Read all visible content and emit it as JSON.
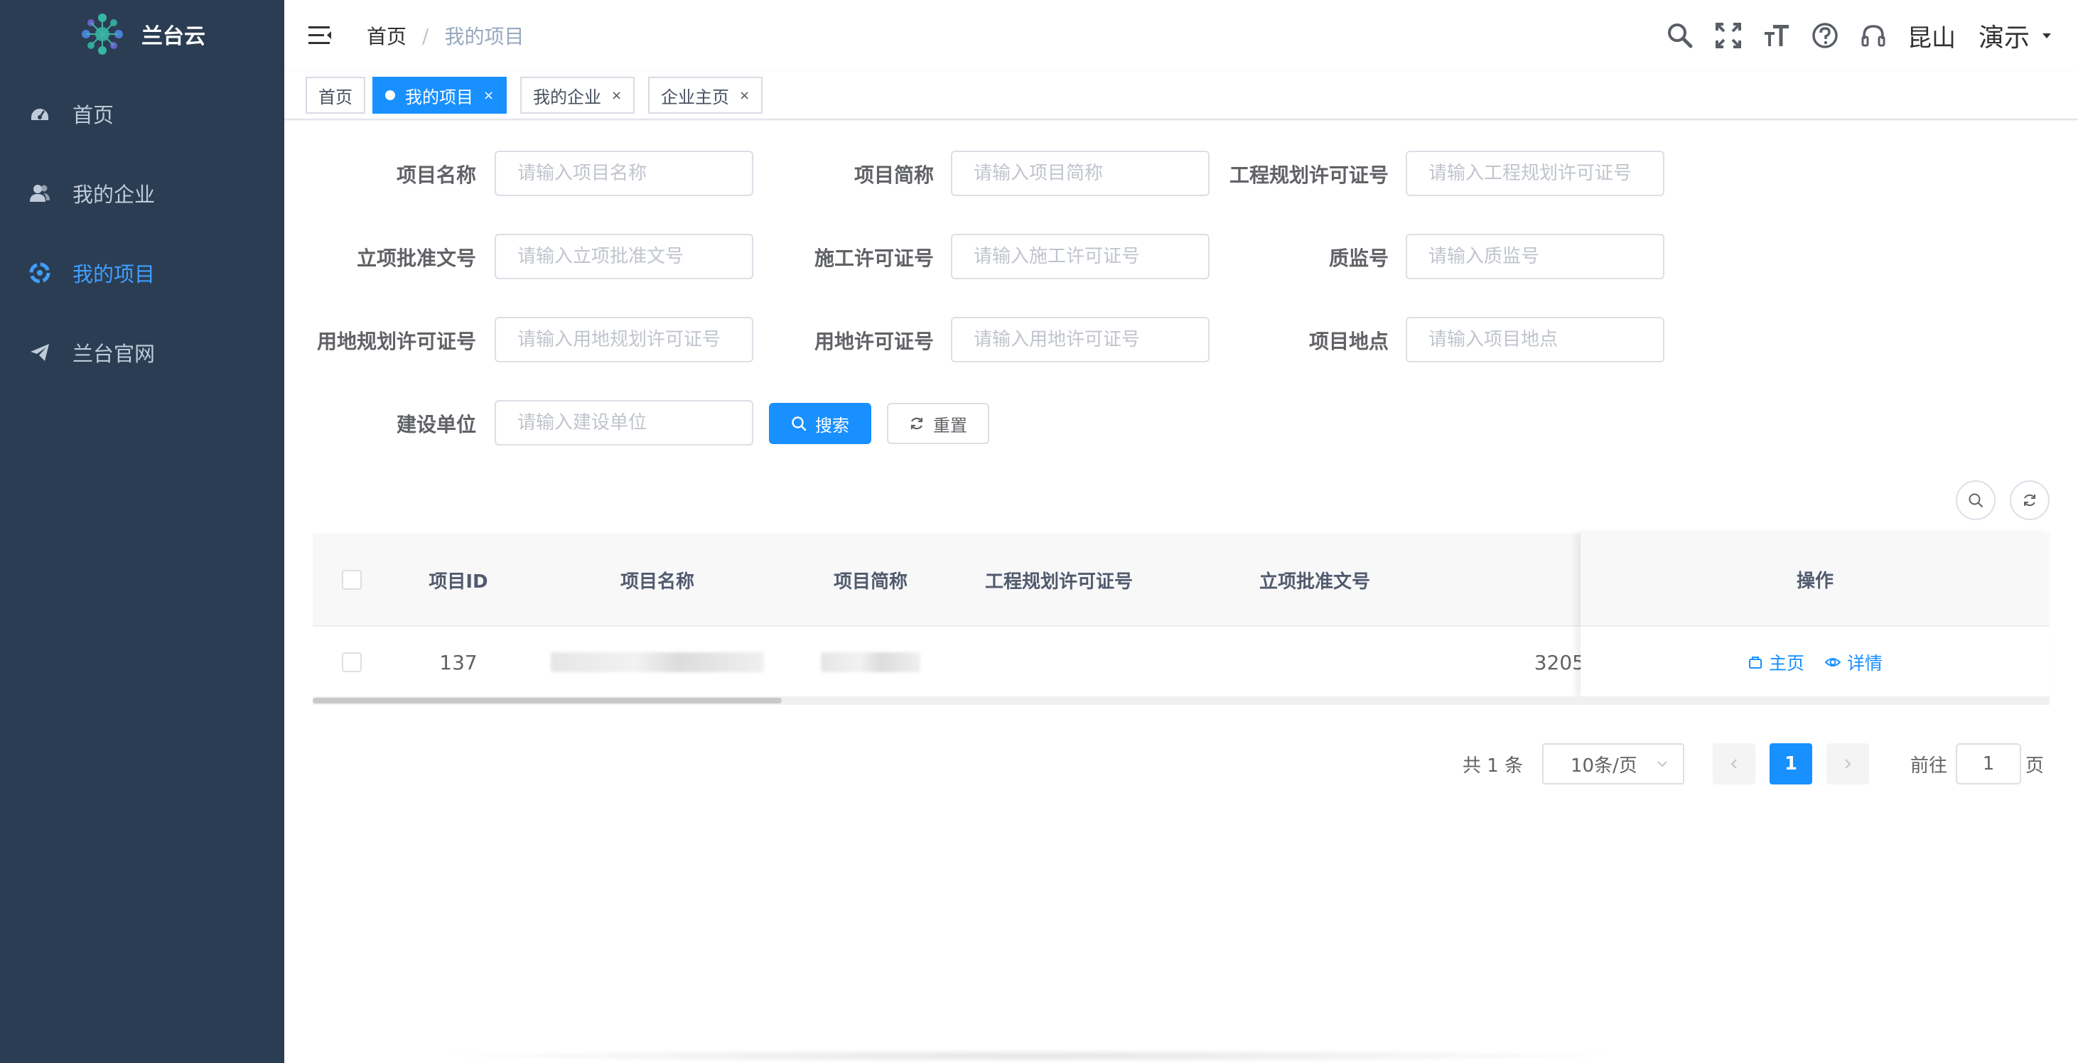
{
  "app": {
    "title": "兰台云"
  },
  "sidebar": {
    "items": [
      {
        "label": "首页",
        "icon": "dashboard-icon",
        "active": false
      },
      {
        "label": "我的企业",
        "icon": "users-icon",
        "active": false
      },
      {
        "label": "我的项目",
        "icon": "project-icon",
        "active": true
      },
      {
        "label": "兰台官网",
        "icon": "send-icon",
        "active": false
      }
    ]
  },
  "navbar": {
    "breadcrumb": [
      "首页",
      "我的项目"
    ],
    "breadcrumb_separator": "/",
    "icons": [
      "search-icon",
      "fullscreen-icon",
      "font-size-icon",
      "help-icon",
      "headset-icon"
    ],
    "location": "昆山",
    "user": "演示"
  },
  "tags": [
    {
      "label": "首页",
      "active": false,
      "closable": false
    },
    {
      "label": "我的项目",
      "active": true,
      "closable": true
    },
    {
      "label": "我的企业",
      "active": false,
      "closable": true
    },
    {
      "label": "企业主页",
      "active": false,
      "closable": true
    }
  ],
  "tag_close": "×",
  "search_form": {
    "fields": [
      {
        "label": "项目名称",
        "placeholder": "请输入项目名称",
        "value": ""
      },
      {
        "label": "项目简称",
        "placeholder": "请输入项目简称",
        "value": ""
      },
      {
        "label": "工程规划许可证号",
        "placeholder": "请输入工程规划许可证号",
        "value": ""
      },
      {
        "label": "立项批准文号",
        "placeholder": "请输入立项批准文号",
        "value": ""
      },
      {
        "label": "施工许可证号",
        "placeholder": "请输入施工许可证号",
        "value": ""
      },
      {
        "label": "质监号",
        "placeholder": "请输入质监号",
        "value": ""
      },
      {
        "label": "用地规划许可证号",
        "placeholder": "请输入用地规划许可证号",
        "value": ""
      },
      {
        "label": "用地许可证号",
        "placeholder": "请输入用地许可证号",
        "value": ""
      },
      {
        "label": "项目地点",
        "placeholder": "请输入项目地点",
        "value": ""
      },
      {
        "label": "建设单位",
        "placeholder": "请输入建设单位",
        "value": ""
      }
    ],
    "search_button": "搜索",
    "reset_button": "重置"
  },
  "table": {
    "columns": [
      "项目ID",
      "项目名称",
      "项目简称",
      "工程规划许可证号",
      "立项批准文号"
    ],
    "action_column": "操作",
    "rows": [
      {
        "id": "137",
        "name": "",
        "short_name": "",
        "plan_permit": "",
        "approval_no": "",
        "partial_value": "3205"
      }
    ],
    "actions": [
      "主页",
      "详情"
    ]
  },
  "pagination": {
    "total_text": "共 1 条",
    "page_size": "10条/页",
    "current_page": "1",
    "goto_prefix": "前往",
    "goto_value": "1",
    "goto_suffix": "页"
  },
  "colors": {
    "sidebar_bg": "#2b3d52",
    "primary": "#1890ff",
    "sidebar_text": "#bfcbd9",
    "active_text": "#409eff"
  }
}
